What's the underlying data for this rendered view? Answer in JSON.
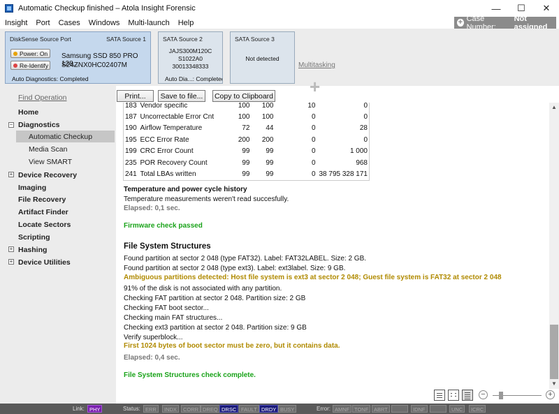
{
  "window": {
    "title": "Automatic Checkup finished – Atola Insight Forensic",
    "minimize": "—",
    "maximize": "☐",
    "close": "✕"
  },
  "menu": [
    "Insight",
    "Port",
    "Cases",
    "Windows",
    "Multi-launch",
    "Help"
  ],
  "case": {
    "label": "Case Number:",
    "value": "Not assigned",
    "plus": "+"
  },
  "sources": {
    "card1": {
      "port": "DiskSense Source Port",
      "source": "SATA Source 1",
      "power_label": "Power: On",
      "reidentify_label": "Re-Identify",
      "model": "Samsung SSD 850 PRO 128...",
      "serial": "S24ZNX0HC02407M",
      "diag": "Auto Diagnostics: Completed"
    },
    "card2": {
      "source": "SATA Source 2",
      "line1": "JAJS300M120C",
      "line2": "S1022A0",
      "line3": "30013348333",
      "diag": "Auto Dia...: Completed"
    },
    "card3": {
      "source": "SATA Source 3",
      "status": "Not detected"
    },
    "multitasking": "Multitasking",
    "plus": "+"
  },
  "sidebar": {
    "find": "Find Operation",
    "home": "Home",
    "diagnostics": "Diagnostics",
    "automatic_checkup": "Automatic Checkup",
    "media_scan": "Media Scan",
    "view_smart": "View SMART",
    "device_recovery": "Device Recovery",
    "imaging": "Imaging",
    "file_recovery": "File Recovery",
    "artifact_finder": "Artifact Finder",
    "locate_sectors": "Locate Sectors",
    "scripting": "Scripting",
    "hashing": "Hashing",
    "device_utilities": "Device Utilities",
    "expand": "+",
    "collapse": "−"
  },
  "toolbar": {
    "print": "Print...",
    "save": "Save to file...",
    "copy": "Copy to Clipboard"
  },
  "smart_rows": [
    [
      "183",
      "Vendor specific",
      "100",
      "100",
      "10",
      "0"
    ],
    [
      "187",
      "Uncorrectable Error Cnt",
      "100",
      "100",
      "0",
      "0"
    ],
    [
      "190",
      "Airflow Temperature",
      "72",
      "44",
      "0",
      "28"
    ],
    [
      "195",
      "ECC Error Rate",
      "200",
      "200",
      "0",
      "0"
    ],
    [
      "199",
      "CRC Error Count",
      "99",
      "99",
      "0",
      "1 000"
    ],
    [
      "235",
      "POR Recovery Count",
      "99",
      "99",
      "0",
      "968"
    ],
    [
      "241",
      "Total LBAs written",
      "99",
      "99",
      "0",
      "38 795 328 171"
    ]
  ],
  "log": {
    "temp_heading": "Temperature and power cycle history",
    "temp_msg": "Temperature measurements weren't read succesfully.",
    "elapsed1": "Elapsed: 0,1 sec.",
    "fw_passed": "Firmware check passed",
    "fs_heading": "File System Structures",
    "fs1": "Found partition at sector 2 048 (type FAT32). Label: FAT32LABEL. Size: 2 GB.",
    "fs2": "Found partition at sector 2 048 (type ext3). Label: ext3label. Size: 9 GB.",
    "fs_warn": "Ambiguous partitions detected: Host file system is ext3 at sector 2 048; Guest file system is FAT32 at sector 2 048",
    "fs3": "91% of the disk is not associated with any partition.",
    "fs4": "Checking FAT partition at sector 2 048. Partition size: 2 GB",
    "fs5": "Checking FAT boot sector...",
    "fs6": "Checking main FAT structures...",
    "fs7": "Checking ext3 partition at sector 2 048. Partition size: 9 GB",
    "fs8": "Verify superblock...",
    "fs_warn2": "First 1024 bytes of boot sector must be zero, but it contains data.",
    "elapsed2": "Elapsed: 0,4 sec.",
    "fs_complete": "File System Structures check complete."
  },
  "zoom": {
    "minus": "−",
    "plus": "+"
  },
  "statusbar": {
    "link_label": "Link:",
    "link": [
      "PHY"
    ],
    "status_label": "Status:",
    "status": [
      "ERR",
      "INDX",
      "CORR",
      "DREQ",
      "DRSC",
      "FAULT",
      "DRDY",
      "BUSY"
    ],
    "error_label": "Error:",
    "errors": [
      "AMNF",
      "TONF",
      "ABRT",
      "",
      "IDNF",
      "",
      "UNC",
      "ICRC"
    ]
  },
  "colors": {
    "ok": "#1aa31a",
    "warn": "#b08a00",
    "active_chip": "#7a1fb0",
    "blue_chip": "#1a1a7a"
  }
}
